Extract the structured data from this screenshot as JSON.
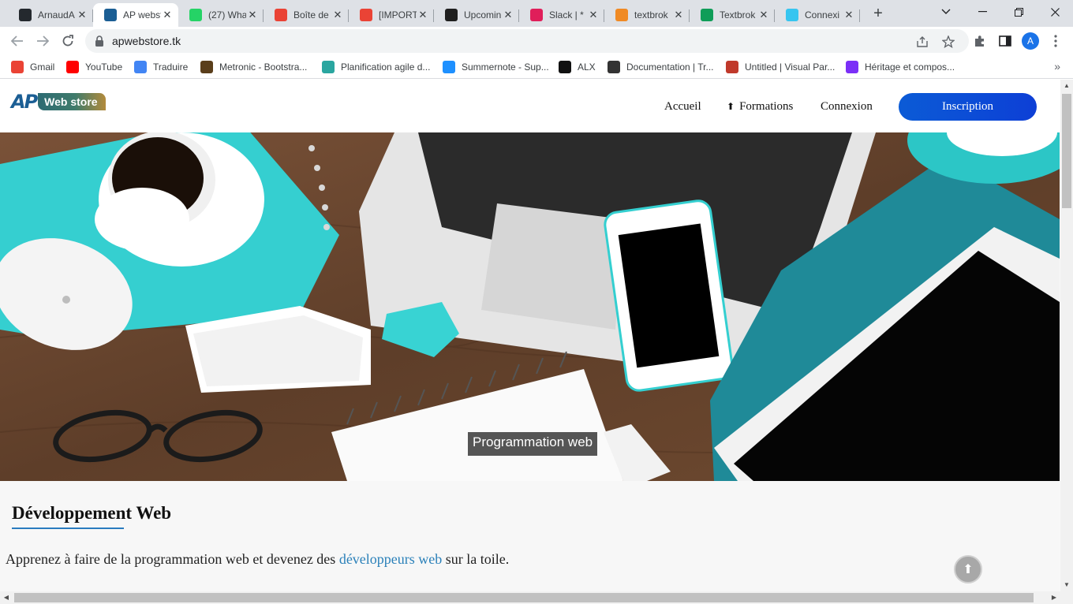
{
  "browser": {
    "tabs": [
      {
        "title": "ArnaudA",
        "icon": "github-icon",
        "color": "#24292e",
        "active": false
      },
      {
        "title": "AP websto",
        "icon": "ap-logo-icon",
        "color": "#1b5e94",
        "active": true
      },
      {
        "title": "(27) Wha",
        "icon": "whatsapp-icon",
        "color": "#25d366",
        "active": false
      },
      {
        "title": "Boîte de",
        "icon": "gmail-icon",
        "color": "#ea4335",
        "active": false
      },
      {
        "title": "[IMPORT",
        "icon": "gmail-icon",
        "color": "#ea4335",
        "active": false
      },
      {
        "title": "Upcomin",
        "icon": "alx-icon",
        "color": "#1f1f1f",
        "active": false
      },
      {
        "title": "Slack | *",
        "icon": "slack-icon",
        "color": "#e01e5a",
        "active": false
      },
      {
        "title": "textbrok",
        "icon": "textbroker-icon",
        "color": "#f08a24",
        "active": false
      },
      {
        "title": "Textbrok",
        "icon": "google-drive-icon",
        "color": "#0f9d58",
        "active": false
      },
      {
        "title": "Connexi",
        "icon": "slack-icon",
        "color": "#36c5f0",
        "active": false
      }
    ],
    "url": "apwebstore.tk",
    "profile_initial": "A",
    "bookmarks": [
      {
        "label": "Gmail",
        "icon": "gmail-icon",
        "color": "#ea4335"
      },
      {
        "label": "YouTube",
        "icon": "youtube-icon",
        "color": "#ff0000"
      },
      {
        "label": "Traduire",
        "icon": "google-translate-icon",
        "color": "#4285f4"
      },
      {
        "label": "Metronic - Bootstra...",
        "icon": "metronic-icon",
        "color": "#5a3e1b"
      },
      {
        "label": "Planification agile d...",
        "icon": "planification-icon",
        "color": "#2aa6a0"
      },
      {
        "label": "Summernote - Sup...",
        "icon": "summernote-icon",
        "color": "#1e90ff"
      },
      {
        "label": "ALX",
        "icon": "alx-icon",
        "color": "#111111"
      },
      {
        "label": "Documentation | Tr...",
        "icon": "tw-icon",
        "color": "#333333"
      },
      {
        "label": "Untitled | Visual Par...",
        "icon": "visual-paradigm-icon",
        "color": "#c0392b"
      },
      {
        "label": "Héritage et compos...",
        "icon": "heritage-icon",
        "color": "#7b2ff7"
      }
    ]
  },
  "site": {
    "logo": {
      "mark": "AP",
      "text": "Web store"
    },
    "nav": {
      "home": "Accueil",
      "courses": "Formations",
      "login": "Connexion",
      "signup": "Inscription"
    },
    "hero_caption": "Programmation web",
    "section": {
      "title": "Développement Web",
      "intro_before": "Apprenez à faire de la programmation web et devenez des ",
      "intro_highlight": "développeurs web",
      "intro_after": " sur la toile."
    },
    "colors": {
      "accent": "#0b5bd6",
      "highlight_text": "#2a80b9",
      "underline": "#2a7bbf"
    }
  }
}
